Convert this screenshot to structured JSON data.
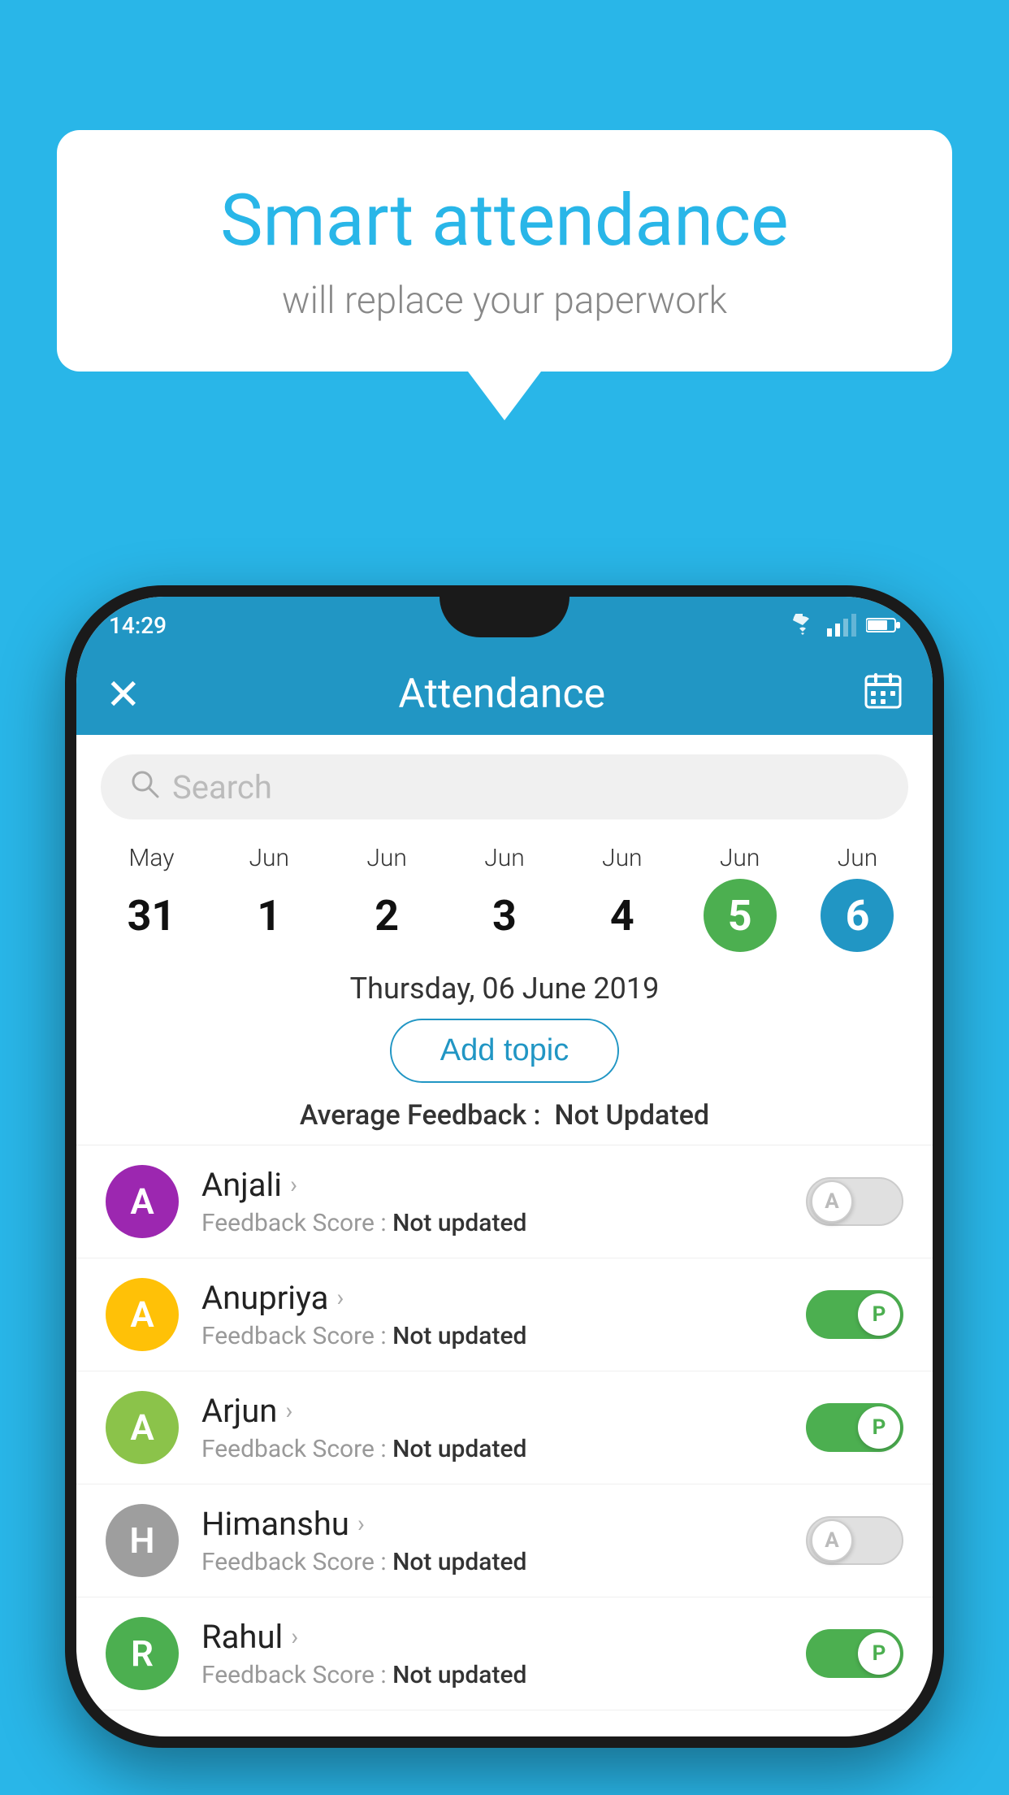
{
  "background_color": "#29b6e8",
  "bubble": {
    "title": "Smart attendance",
    "subtitle": "will replace your paperwork"
  },
  "status_bar": {
    "time": "14:29",
    "wifi_icon": "wifi",
    "signal_icon": "signal",
    "battery_icon": "battery"
  },
  "app_bar": {
    "title": "Attendance",
    "close_label": "✕",
    "calendar_label": "📅"
  },
  "search": {
    "placeholder": "Search"
  },
  "calendar": {
    "days": [
      {
        "month": "May",
        "date": "31",
        "style": "normal"
      },
      {
        "month": "Jun",
        "date": "1",
        "style": "normal"
      },
      {
        "month": "Jun",
        "date": "2",
        "style": "normal"
      },
      {
        "month": "Jun",
        "date": "3",
        "style": "normal"
      },
      {
        "month": "Jun",
        "date": "4",
        "style": "normal"
      },
      {
        "month": "Jun",
        "date": "5",
        "style": "today"
      },
      {
        "month": "Jun",
        "date": "6",
        "style": "selected"
      }
    ],
    "selected_date": "Thursday, 06 June 2019"
  },
  "add_topic_label": "Add topic",
  "average_feedback": {
    "label": "Average Feedback :",
    "value": "Not Updated"
  },
  "students": [
    {
      "name": "Anjali",
      "avatar_letter": "A",
      "avatar_color": "#9c27b0",
      "feedback_label": "Feedback Score :",
      "feedback_value": "Not updated",
      "attendance": "absent"
    },
    {
      "name": "Anupriya",
      "avatar_letter": "A",
      "avatar_color": "#ffc107",
      "feedback_label": "Feedback Score :",
      "feedback_value": "Not updated",
      "attendance": "present"
    },
    {
      "name": "Arjun",
      "avatar_letter": "A",
      "avatar_color": "#8bc34a",
      "feedback_label": "Feedback Score :",
      "feedback_value": "Not updated",
      "attendance": "present"
    },
    {
      "name": "Himanshu",
      "avatar_letter": "H",
      "avatar_color": "#9e9e9e",
      "feedback_label": "Feedback Score :",
      "feedback_value": "Not updated",
      "attendance": "absent"
    },
    {
      "name": "Rahul",
      "avatar_letter": "R",
      "avatar_color": "#4caf50",
      "feedback_label": "Feedback Score :",
      "feedback_value": "Not updated",
      "attendance": "present"
    }
  ]
}
